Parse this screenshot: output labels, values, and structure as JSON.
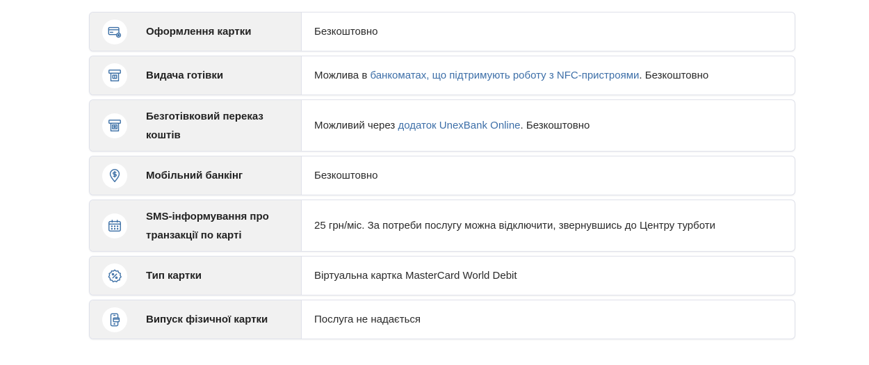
{
  "rows": [
    {
      "icon": "card-settings-icon",
      "label": "Оформлення картки",
      "value": "Безкоштовно"
    },
    {
      "icon": "atm-icon",
      "label": "Видача готівки",
      "value_before": "Можлива в ",
      "link": "банкоматах, що підтримують роботу з NFC-пристроями",
      "value_after": ". Безкоштовно"
    },
    {
      "icon": "atm-transfer-icon",
      "label": "Безготівковий переказ коштів",
      "value_before": "Можливий через ",
      "link": "додаток UnexBank Online",
      "value_after": ". Безкоштовно"
    },
    {
      "icon": "money-location-icon",
      "label": "Мобільний банкінг",
      "value": "Безкоштовно"
    },
    {
      "icon": "calendar-icon",
      "label": "SMS-інформування про транзакції по карті",
      "value": "25 грн/міс. За потреби послугу можна відключити, звернувшись до Центру турботи"
    },
    {
      "icon": "percent-badge-icon",
      "label": "Тип картки",
      "value": "Віртуальна картка MasterCard World Debit"
    },
    {
      "icon": "phone-card-icon",
      "label": "Випуск фізичної картки",
      "value": "Послуга не надається"
    }
  ],
  "colors": {
    "icon": "#3a6ea5",
    "link": "#3d6fa8",
    "label_bg": "#f1f1f1",
    "border": "#dfe1ea"
  }
}
